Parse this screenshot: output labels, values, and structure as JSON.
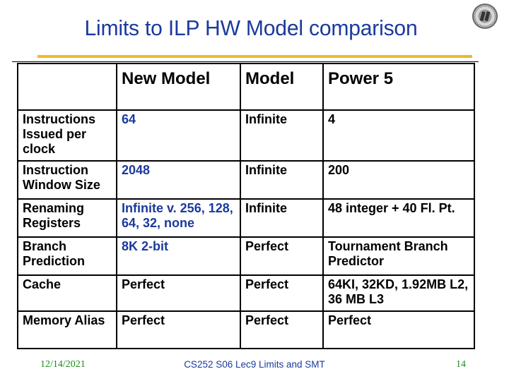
{
  "slide": {
    "title": "Limits to ILP HW Model comparison",
    "logo_icon": "university-seal-icon"
  },
  "table": {
    "headers": [
      "",
      "New Model",
      "Model",
      "Power 5"
    ],
    "rows": [
      {
        "label": "Instructions Issued per clock",
        "new_model": "64",
        "model": "Infinite",
        "power5": "4"
      },
      {
        "label": "Instruction Window Size",
        "new_model": "2048",
        "model": "Infinite",
        "power5": "200"
      },
      {
        "label": "Renaming Registers",
        "new_model": "Infinite v. 256, 128, 64, 32, none",
        "model": "Infinite",
        "power5": "48 integer + 40 Fl. Pt."
      },
      {
        "label": "Branch Prediction",
        "new_model": "8K 2-bit",
        "model": "Perfect",
        "power5": "Tournament Branch Predictor"
      },
      {
        "label": "Cache",
        "new_model": "Perfect",
        "model": "Perfect",
        "power5": "64KI, 32KD, 1.92MB L2, 36 MB L3"
      },
      {
        "label": "Memory Alias",
        "new_model": "Perfect",
        "model": "Perfect",
        "power5": "Perfect"
      }
    ]
  },
  "footer": {
    "date": "12/14/2021",
    "center": "CS252 S06 Lec9 Limits and SMT",
    "page": "14"
  },
  "colors": {
    "title": "#1a3a9c",
    "highlight_text": "#1a3a9c",
    "rule": "#eeb92a",
    "footer_side": "#1f8a1f"
  }
}
